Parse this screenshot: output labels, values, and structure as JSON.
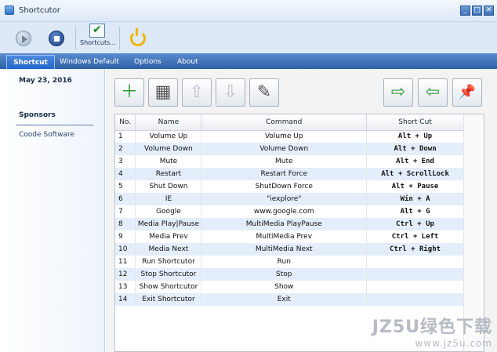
{
  "window": {
    "title": "Shortcutor",
    "controls": [
      "_",
      "□",
      "✕"
    ]
  },
  "toolbar": {
    "shortcuts_label": "Shortcuts..."
  },
  "tabs": [
    "Shortcut",
    "Windows Default",
    "Options",
    "About"
  ],
  "sidebar": {
    "date": "May 23, 2016",
    "sponsors_heading": "Sponsors",
    "sponsor_link": "Coode Software"
  },
  "actions": [
    {
      "name": "add-shortcut-icon",
      "glyph": "＋"
    },
    {
      "name": "edit-table-icon",
      "glyph": "▦"
    },
    {
      "name": "move-up-icon",
      "glyph": "⇧"
    },
    {
      "name": "move-down-icon",
      "glyph": "⇩"
    },
    {
      "name": "rename-icon",
      "glyph": "✎"
    },
    {
      "name": "export-icon",
      "glyph": "⇨"
    },
    {
      "name": "import-icon",
      "glyph": "⇦"
    },
    {
      "name": "pin-icon",
      "glyph": "📌"
    }
  ],
  "table": {
    "headers": [
      "No.",
      "Name",
      "Command",
      "Short Cut"
    ],
    "rows": [
      [
        "1",
        "Volume Up",
        "Volume Up",
        "Alt + Up"
      ],
      [
        "2",
        "Volume Down",
        "Volume Down",
        "Alt + Down"
      ],
      [
        "3",
        "Mute",
        "Mute",
        "Alt + End"
      ],
      [
        "4",
        "Restart",
        "Restart Force",
        "Alt + ScrollLock"
      ],
      [
        "5",
        "Shut Down",
        "ShutDown Force",
        "Alt + Pause"
      ],
      [
        "6",
        "IE",
        "\"iexplore\"",
        "Win + A"
      ],
      [
        "7",
        "Google",
        "www.google.com",
        "Alt + G"
      ],
      [
        "8",
        "Media Play|Pause",
        "MultiMedia PlayPause",
        "Ctrl + Up"
      ],
      [
        "9",
        "Media Prev",
        "MultiMedia Prev",
        "Ctrl + Left"
      ],
      [
        "10",
        "Media Next",
        "MultiMedia Next",
        "Ctrl + Right"
      ],
      [
        "11",
        "Run Shortcutor",
        "Run",
        ""
      ],
      [
        "12",
        "Stop Shortcutor",
        "Stop",
        ""
      ],
      [
        "13",
        "Show Shortcutor",
        "Show",
        ""
      ],
      [
        "14",
        "Exit Shortcutor",
        "Exit",
        ""
      ]
    ]
  },
  "watermark": {
    "line1": "JZ5U绿色下载",
    "line2": "www.jz5u.com"
  },
  "colors": {
    "tab_strip": "#2f5fa5",
    "active_tab": "#1f66c9",
    "alt_row": "#e4eefb",
    "sidebar_line": "#5b7fb8"
  }
}
